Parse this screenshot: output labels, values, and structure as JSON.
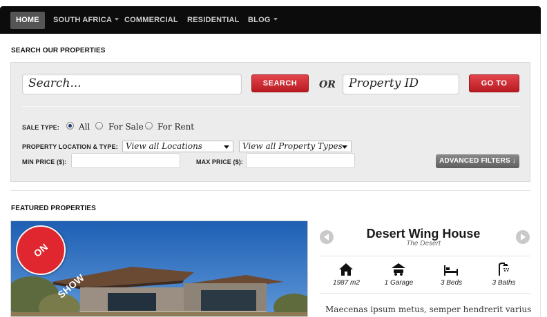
{
  "nav": {
    "items": [
      {
        "label": "HOME",
        "active": true,
        "dropdown": false
      },
      {
        "label": "SOUTH AFRICA",
        "active": false,
        "dropdown": true
      },
      {
        "label": "COMMERCIAL",
        "active": false,
        "dropdown": false
      },
      {
        "label": "RESIDENTIAL",
        "active": false,
        "dropdown": false
      },
      {
        "label": "BLOG",
        "active": false,
        "dropdown": true
      }
    ]
  },
  "search": {
    "title": "SEARCH OUR PROPERTIES",
    "keyword_placeholder": "Search...",
    "search_button": "SEARCH",
    "or_label": "OR",
    "property_id_placeholder": "Property ID",
    "goto_button": "GO TO",
    "sale_type_label": "SALE TYPE:",
    "sale_type_options": [
      "All",
      "For Sale",
      "For Rent"
    ],
    "sale_type_selected": "All",
    "location_type_label": "PROPERTY LOCATION & TYPE:",
    "location_select": "View all Locations",
    "type_select": "View all Property Types",
    "min_price_label": "MIN PRICE ($):",
    "max_price_label": "MAX PRICE ($):",
    "advanced_button": "ADVANCED FILTERS ↓"
  },
  "featured": {
    "title": "FEATURED PROPERTIES",
    "badge": "ON SHOW",
    "property": {
      "name": "Desert Wing House",
      "location": "The Desert",
      "features": [
        {
          "icon": "house-icon",
          "text": "1987 m2"
        },
        {
          "icon": "garage-icon",
          "text": "1 Garage"
        },
        {
          "icon": "bed-icon",
          "text": "3 Beds"
        },
        {
          "icon": "shower-icon",
          "text": "3 Baths"
        }
      ],
      "description": "Maecenas ipsum metus, semper hendrerit varius"
    }
  },
  "colors": {
    "nav_bg": "#0c0c0c",
    "accent_red": "#c8232a",
    "panel_bg": "#ececec"
  }
}
